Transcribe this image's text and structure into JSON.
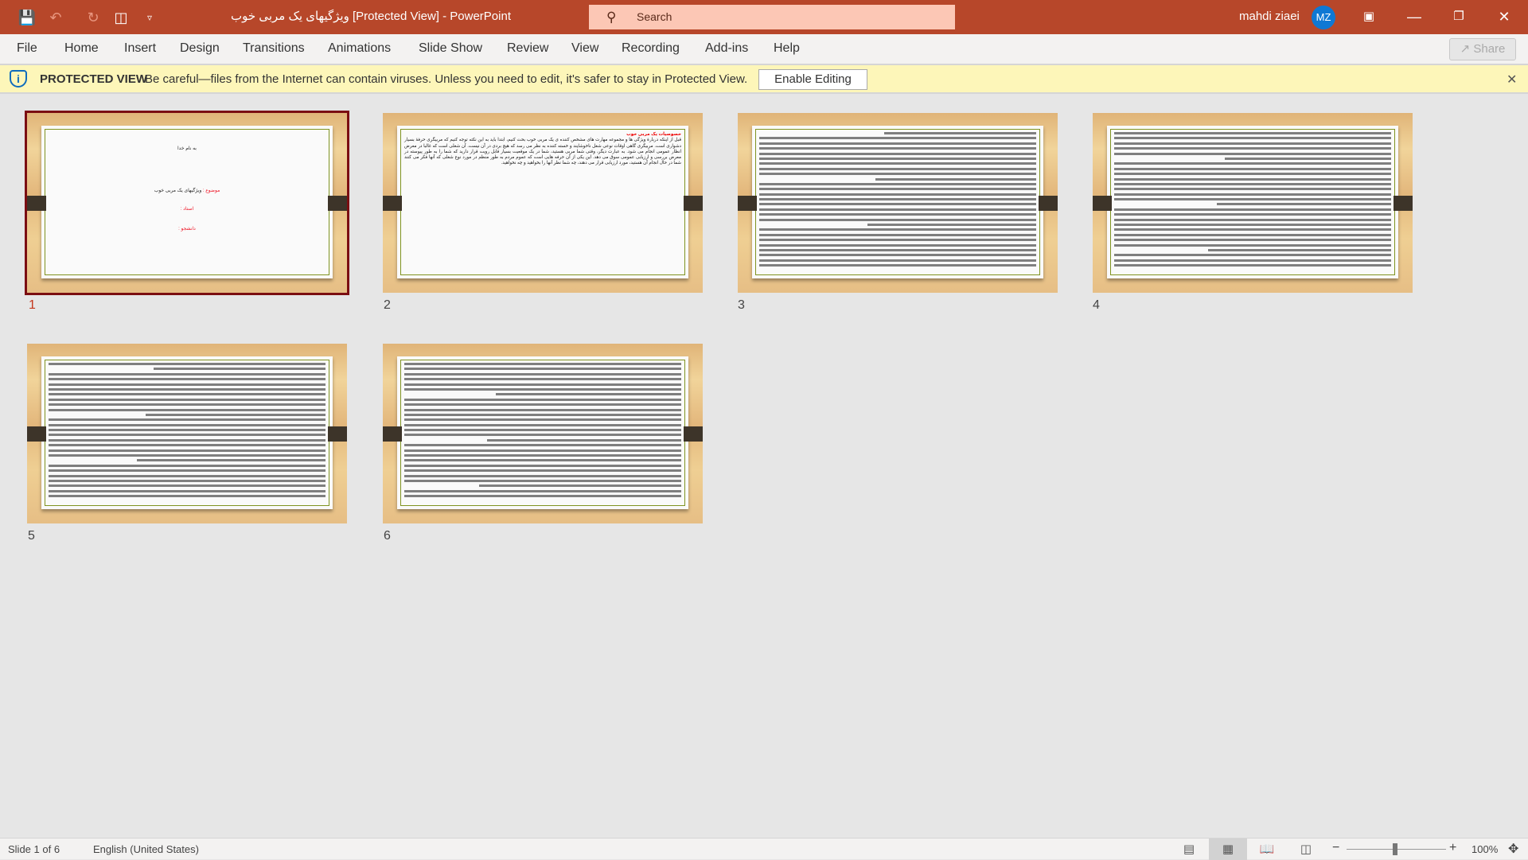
{
  "titlebar": {
    "title": "ویژگیهای یک مربی خوب [Protected View]  -  PowerPoint",
    "search_placeholder": "Search",
    "user_name": "mahdi ziaei",
    "user_initials": "MZ",
    "icons": [
      "save-icon",
      "undo-icon",
      "redo-icon",
      "start-from-beginning-icon",
      "customize-qat-icon"
    ]
  },
  "ribbon": {
    "tabs": [
      "File",
      "Home",
      "Insert",
      "Design",
      "Transitions",
      "Animations",
      "Slide Show",
      "Review",
      "View",
      "Recording",
      "Add-ins",
      "Help"
    ],
    "share_label": "Share"
  },
  "protected_view": {
    "label": "PROTECTED VIEW",
    "message": "Be careful—files from the Internet can contain viruses. Unless you need to edit, it's safer to stay in Protected View.",
    "enable_button": "Enable Editing"
  },
  "slides": [
    {
      "number": "1",
      "selected": true,
      "lines": [
        "به نام خدا",
        "موضوع : ",
        "ویژگیهای یک مربی خوب",
        "استاد :",
        "دانشجو :"
      ]
    },
    {
      "number": "2",
      "title": "خصوصیات یک مربی خوب",
      "text": "قبل از اینکه دربارهٔ ویژگی ها و مجموعه مهارت های مشخص کننده ی یک مربی خوب بحث کنیم، ابتدا باید به این نکته توجه کنیم که مربیگری حرفهٔ بسیار دشواری است. مربیگری گاهی اوقات نوعی شغل ناخوشایند و خسته کننده به نظر می رسد که هیچ بردی در آن نیست. آن شغلی است که غالبا در معرض انظار عمومی انجام می شود. به عبارت دیگر، وقتی شما مربی هستید، شما در یک موقعیت بسیار قابل رویت قرار دارید که شما را به طور پیوسته در معرض بررسی و ارزیابی عمومی سوق می دهد. این یکی از آن حرفه هایی است که عموم مردم به طور منظم در مورد نوع شغلی که آنها فکر می کنند شما در حال انجام آن هستید، مورد ارزیابی قرار می دهند، چه شما نظر آنها را بخواهید و چه نخواهید."
    },
    {
      "number": "3"
    },
    {
      "number": "4"
    },
    {
      "number": "5"
    },
    {
      "number": "6"
    }
  ],
  "status": {
    "slide_info": "Slide 1 of 6",
    "language": "English (United States)",
    "zoom": "100%",
    "zoom_percent": 100,
    "active_view": "slide-sorter"
  },
  "colors": {
    "titlebar": "#b7472a",
    "selection": "#7b0e12",
    "accent_number": "#c4371c",
    "avatar": "#0f78d4"
  }
}
